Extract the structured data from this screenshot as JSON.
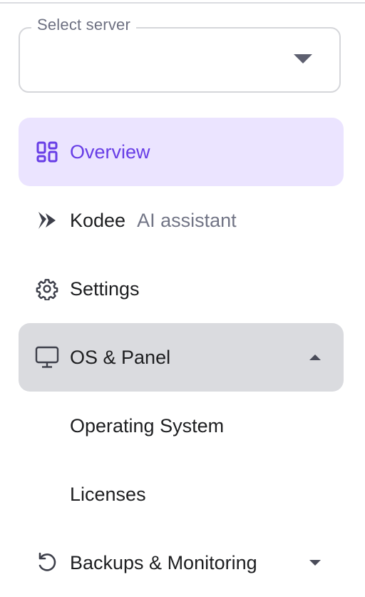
{
  "server_select": {
    "label": "Select server",
    "value": ""
  },
  "nav": {
    "overview": {
      "label": "Overview",
      "icon": "dashboard-grid-icon"
    },
    "kodee": {
      "label": "Kodee",
      "sublabel": "AI assistant",
      "icon": "kodee-sparkle-icon"
    },
    "settings": {
      "label": "Settings",
      "icon": "gear-icon"
    },
    "os_panel": {
      "label": "OS & Panel",
      "icon": "monitor-icon",
      "expanded": true
    },
    "os_panel_children": [
      {
        "label": "Operating System"
      },
      {
        "label": "Licenses"
      }
    ],
    "backups": {
      "label": "Backups & Monitoring",
      "icon": "restore-icon",
      "expanded": false
    }
  },
  "colors": {
    "accent": "#673de6",
    "active_bg": "#ebe4ff",
    "expanded_bg": "#dadbdf",
    "text": "#1d1e20",
    "muted": "#727586"
  }
}
